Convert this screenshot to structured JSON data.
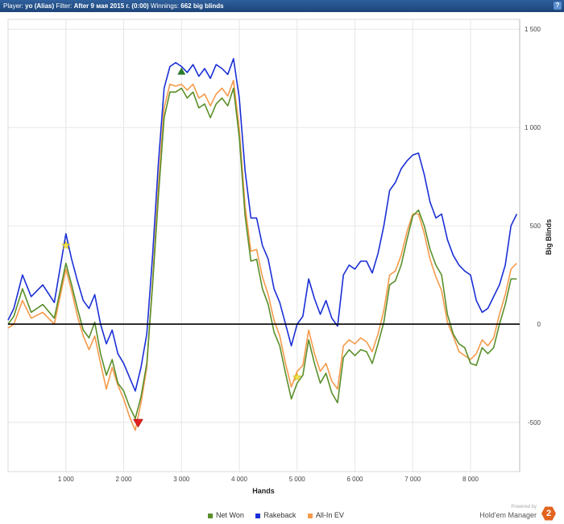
{
  "header": {
    "player_label": "Player:",
    "player_value": "yo (Alias)",
    "filter_label": "Filter:",
    "filter_value": "After 9 мая 2015 г. (0:00)",
    "winnings_label": "Winnings:",
    "winnings_value": "662 big blinds",
    "help_label": "?"
  },
  "branding": {
    "powered_by": "Powered by",
    "product": "Hold'em Manager",
    "logo_text": "2"
  },
  "chart_data": {
    "type": "line",
    "xlabel": "Hands",
    "ylabel": "Big Blinds",
    "xlim": [
      0,
      8850
    ],
    "ylim": [
      -750,
      1550
    ],
    "x_ticks": [
      1000,
      2000,
      3000,
      4000,
      5000,
      6000,
      7000,
      8000
    ],
    "x_tick_labels": [
      "1 000",
      "2 000",
      "3 000",
      "4 000",
      "5 000",
      "6 000",
      "7 000",
      "8 000"
    ],
    "y_ticks": [
      1500,
      1000,
      500,
      0,
      -500
    ],
    "y_tick_labels": [
      "1 500",
      "1 000",
      "500",
      "0",
      "-500"
    ],
    "grid": true,
    "legend_position": "bottom",
    "colors": {
      "net_won": "#5a8f2a",
      "rakeback": "#1a2fd6",
      "allin_ev": "#f59a4a"
    },
    "markers": [
      {
        "type": "max-star",
        "x": 1000,
        "y": 400,
        "color": "#f2e24a"
      },
      {
        "type": "max-triangle",
        "x": 3000,
        "y": 1285,
        "color": "#2a7a2a"
      },
      {
        "type": "min-triangle",
        "x": 2250,
        "y": -500,
        "color": "#e02020"
      },
      {
        "type": "min-star",
        "x": 5000,
        "y": -270,
        "color": "#f2e24a"
      }
    ],
    "series": [
      {
        "name": "Net Won",
        "x": [
          0,
          100,
          250,
          400,
          600,
          800,
          1000,
          1100,
          1200,
          1300,
          1400,
          1500,
          1600,
          1700,
          1800,
          1900,
          2000,
          2100,
          2200,
          2300,
          2400,
          2500,
          2600,
          2700,
          2800,
          2900,
          3000,
          3100,
          3200,
          3300,
          3400,
          3500,
          3600,
          3700,
          3800,
          3900,
          4000,
          4100,
          4200,
          4300,
          4400,
          4500,
          4600,
          4700,
          4800,
          4900,
          5000,
          5100,
          5200,
          5300,
          5400,
          5500,
          5600,
          5700,
          5800,
          5900,
          6000,
          6100,
          6200,
          6300,
          6400,
          6500,
          6600,
          6700,
          6800,
          6900,
          7000,
          7100,
          7200,
          7300,
          7400,
          7500,
          7600,
          7700,
          7800,
          7900,
          8000,
          8100,
          8200,
          8300,
          8400,
          8500,
          8600,
          8700,
          8800
        ],
        "y": [
          0,
          40,
          180,
          60,
          100,
          30,
          310,
          200,
          80,
          -30,
          -70,
          10,
          -150,
          -260,
          -180,
          -300,
          -340,
          -420,
          -480,
          -370,
          -200,
          200,
          650,
          1050,
          1180,
          1180,
          1200,
          1150,
          1180,
          1100,
          1120,
          1050,
          1120,
          1150,
          1110,
          1200,
          950,
          550,
          320,
          330,
          180,
          100,
          -40,
          -110,
          -250,
          -380,
          -300,
          -260,
          -80,
          -200,
          -300,
          -250,
          -350,
          -400,
          -170,
          -130,
          -160,
          -130,
          -140,
          -200,
          -100,
          10,
          200,
          220,
          300,
          430,
          550,
          580,
          500,
          380,
          300,
          250,
          50,
          -50,
          -100,
          -120,
          -200,
          -210,
          -120,
          -150,
          -120,
          0,
          100,
          230,
          230
        ]
      },
      {
        "name": "Rakeback",
        "x": [
          0,
          100,
          250,
          400,
          600,
          800,
          1000,
          1100,
          1200,
          1300,
          1400,
          1500,
          1600,
          1700,
          1800,
          1900,
          2000,
          2100,
          2200,
          2300,
          2400,
          2500,
          2600,
          2700,
          2800,
          2900,
          3000,
          3100,
          3200,
          3300,
          3400,
          3500,
          3600,
          3700,
          3800,
          3900,
          4000,
          4100,
          4200,
          4300,
          4400,
          4500,
          4600,
          4700,
          4800,
          4900,
          5000,
          5100,
          5200,
          5300,
          5400,
          5500,
          5600,
          5700,
          5800,
          5900,
          6000,
          6100,
          6200,
          6300,
          6400,
          6500,
          6600,
          6700,
          6800,
          6900,
          7000,
          7100,
          7200,
          7300,
          7400,
          7500,
          7600,
          7700,
          7800,
          7900,
          8000,
          8100,
          8200,
          8300,
          8400,
          8500,
          8600,
          8700,
          8800
        ],
        "y": [
          20,
          80,
          250,
          140,
          200,
          110,
          460,
          330,
          220,
          120,
          80,
          150,
          0,
          -100,
          -30,
          -150,
          -200,
          -270,
          -340,
          -220,
          -50,
          350,
          820,
          1200,
          1310,
          1330,
          1310,
          1280,
          1320,
          1260,
          1300,
          1250,
          1320,
          1300,
          1270,
          1350,
          1150,
          780,
          540,
          540,
          400,
          330,
          180,
          110,
          0,
          -110,
          0,
          40,
          230,
          130,
          50,
          120,
          30,
          -10,
          250,
          300,
          280,
          320,
          320,
          260,
          360,
          500,
          680,
          720,
          790,
          830,
          860,
          870,
          760,
          620,
          540,
          560,
          430,
          350,
          300,
          270,
          250,
          120,
          60,
          80,
          140,
          200,
          300,
          500,
          560
        ]
      },
      {
        "name": "All-In EV",
        "x": [
          0,
          100,
          250,
          400,
          600,
          800,
          1000,
          1100,
          1200,
          1300,
          1400,
          1500,
          1600,
          1700,
          1800,
          1900,
          2000,
          2100,
          2200,
          2300,
          2400,
          2500,
          2600,
          2700,
          2800,
          2900,
          3000,
          3100,
          3200,
          3300,
          3400,
          3500,
          3600,
          3700,
          3800,
          3900,
          4000,
          4100,
          4200,
          4300,
          4400,
          4500,
          4600,
          4700,
          4800,
          4900,
          5000,
          5100,
          5200,
          5300,
          5400,
          5500,
          5600,
          5700,
          5800,
          5900,
          6000,
          6100,
          6200,
          6300,
          6400,
          6500,
          6600,
          6700,
          6800,
          6900,
          7000,
          7100,
          7200,
          7300,
          7400,
          7500,
          7600,
          7700,
          7800,
          7900,
          8000,
          8100,
          8200,
          8300,
          8400,
          8500,
          8600,
          8700,
          8800
        ],
        "y": [
          -20,
          0,
          120,
          30,
          60,
          0,
          280,
          170,
          40,
          -60,
          -130,
          -60,
          -200,
          -330,
          -220,
          -310,
          -380,
          -470,
          -540,
          -400,
          -220,
          220,
          700,
          1100,
          1220,
          1210,
          1220,
          1190,
          1220,
          1150,
          1170,
          1110,
          1170,
          1200,
          1160,
          1240,
          990,
          600,
          370,
          380,
          240,
          150,
          20,
          -60,
          -200,
          -320,
          -240,
          -210,
          -30,
          -150,
          -240,
          -200,
          -290,
          -330,
          -110,
          -80,
          -100,
          -70,
          -90,
          -140,
          -50,
          70,
          250,
          270,
          350,
          470,
          560,
          560,
          460,
          330,
          240,
          170,
          10,
          -60,
          -140,
          -160,
          -180,
          -150,
          -80,
          -110,
          -70,
          50,
          150,
          280,
          310
        ]
      }
    ]
  }
}
